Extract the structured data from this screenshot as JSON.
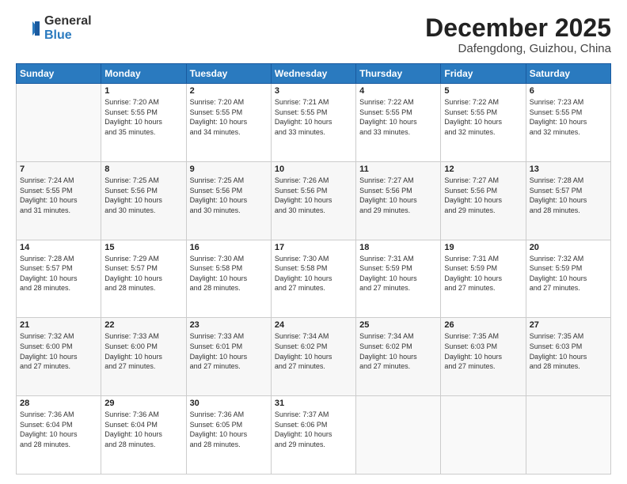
{
  "header": {
    "logo_general": "General",
    "logo_blue": "Blue",
    "month_title": "December 2025",
    "location": "Dafengdong, Guizhou, China"
  },
  "days_of_week": [
    "Sunday",
    "Monday",
    "Tuesday",
    "Wednesday",
    "Thursday",
    "Friday",
    "Saturday"
  ],
  "weeks": [
    [
      {
        "num": "",
        "info": ""
      },
      {
        "num": "1",
        "info": "Sunrise: 7:20 AM\nSunset: 5:55 PM\nDaylight: 10 hours\nand 35 minutes."
      },
      {
        "num": "2",
        "info": "Sunrise: 7:20 AM\nSunset: 5:55 PM\nDaylight: 10 hours\nand 34 minutes."
      },
      {
        "num": "3",
        "info": "Sunrise: 7:21 AM\nSunset: 5:55 PM\nDaylight: 10 hours\nand 33 minutes."
      },
      {
        "num": "4",
        "info": "Sunrise: 7:22 AM\nSunset: 5:55 PM\nDaylight: 10 hours\nand 33 minutes."
      },
      {
        "num": "5",
        "info": "Sunrise: 7:22 AM\nSunset: 5:55 PM\nDaylight: 10 hours\nand 32 minutes."
      },
      {
        "num": "6",
        "info": "Sunrise: 7:23 AM\nSunset: 5:55 PM\nDaylight: 10 hours\nand 32 minutes."
      }
    ],
    [
      {
        "num": "7",
        "info": "Sunrise: 7:24 AM\nSunset: 5:55 PM\nDaylight: 10 hours\nand 31 minutes."
      },
      {
        "num": "8",
        "info": "Sunrise: 7:25 AM\nSunset: 5:56 PM\nDaylight: 10 hours\nand 30 minutes."
      },
      {
        "num": "9",
        "info": "Sunrise: 7:25 AM\nSunset: 5:56 PM\nDaylight: 10 hours\nand 30 minutes."
      },
      {
        "num": "10",
        "info": "Sunrise: 7:26 AM\nSunset: 5:56 PM\nDaylight: 10 hours\nand 30 minutes."
      },
      {
        "num": "11",
        "info": "Sunrise: 7:27 AM\nSunset: 5:56 PM\nDaylight: 10 hours\nand 29 minutes."
      },
      {
        "num": "12",
        "info": "Sunrise: 7:27 AM\nSunset: 5:56 PM\nDaylight: 10 hours\nand 29 minutes."
      },
      {
        "num": "13",
        "info": "Sunrise: 7:28 AM\nSunset: 5:57 PM\nDaylight: 10 hours\nand 28 minutes."
      }
    ],
    [
      {
        "num": "14",
        "info": "Sunrise: 7:28 AM\nSunset: 5:57 PM\nDaylight: 10 hours\nand 28 minutes."
      },
      {
        "num": "15",
        "info": "Sunrise: 7:29 AM\nSunset: 5:57 PM\nDaylight: 10 hours\nand 28 minutes."
      },
      {
        "num": "16",
        "info": "Sunrise: 7:30 AM\nSunset: 5:58 PM\nDaylight: 10 hours\nand 28 minutes."
      },
      {
        "num": "17",
        "info": "Sunrise: 7:30 AM\nSunset: 5:58 PM\nDaylight: 10 hours\nand 27 minutes."
      },
      {
        "num": "18",
        "info": "Sunrise: 7:31 AM\nSunset: 5:59 PM\nDaylight: 10 hours\nand 27 minutes."
      },
      {
        "num": "19",
        "info": "Sunrise: 7:31 AM\nSunset: 5:59 PM\nDaylight: 10 hours\nand 27 minutes."
      },
      {
        "num": "20",
        "info": "Sunrise: 7:32 AM\nSunset: 5:59 PM\nDaylight: 10 hours\nand 27 minutes."
      }
    ],
    [
      {
        "num": "21",
        "info": "Sunrise: 7:32 AM\nSunset: 6:00 PM\nDaylight: 10 hours\nand 27 minutes."
      },
      {
        "num": "22",
        "info": "Sunrise: 7:33 AM\nSunset: 6:00 PM\nDaylight: 10 hours\nand 27 minutes."
      },
      {
        "num": "23",
        "info": "Sunrise: 7:33 AM\nSunset: 6:01 PM\nDaylight: 10 hours\nand 27 minutes."
      },
      {
        "num": "24",
        "info": "Sunrise: 7:34 AM\nSunset: 6:02 PM\nDaylight: 10 hours\nand 27 minutes."
      },
      {
        "num": "25",
        "info": "Sunrise: 7:34 AM\nSunset: 6:02 PM\nDaylight: 10 hours\nand 27 minutes."
      },
      {
        "num": "26",
        "info": "Sunrise: 7:35 AM\nSunset: 6:03 PM\nDaylight: 10 hours\nand 27 minutes."
      },
      {
        "num": "27",
        "info": "Sunrise: 7:35 AM\nSunset: 6:03 PM\nDaylight: 10 hours\nand 28 minutes."
      }
    ],
    [
      {
        "num": "28",
        "info": "Sunrise: 7:36 AM\nSunset: 6:04 PM\nDaylight: 10 hours\nand 28 minutes."
      },
      {
        "num": "29",
        "info": "Sunrise: 7:36 AM\nSunset: 6:04 PM\nDaylight: 10 hours\nand 28 minutes."
      },
      {
        "num": "30",
        "info": "Sunrise: 7:36 AM\nSunset: 6:05 PM\nDaylight: 10 hours\nand 28 minutes."
      },
      {
        "num": "31",
        "info": "Sunrise: 7:37 AM\nSunset: 6:06 PM\nDaylight: 10 hours\nand 29 minutes."
      },
      {
        "num": "",
        "info": ""
      },
      {
        "num": "",
        "info": ""
      },
      {
        "num": "",
        "info": ""
      }
    ]
  ]
}
